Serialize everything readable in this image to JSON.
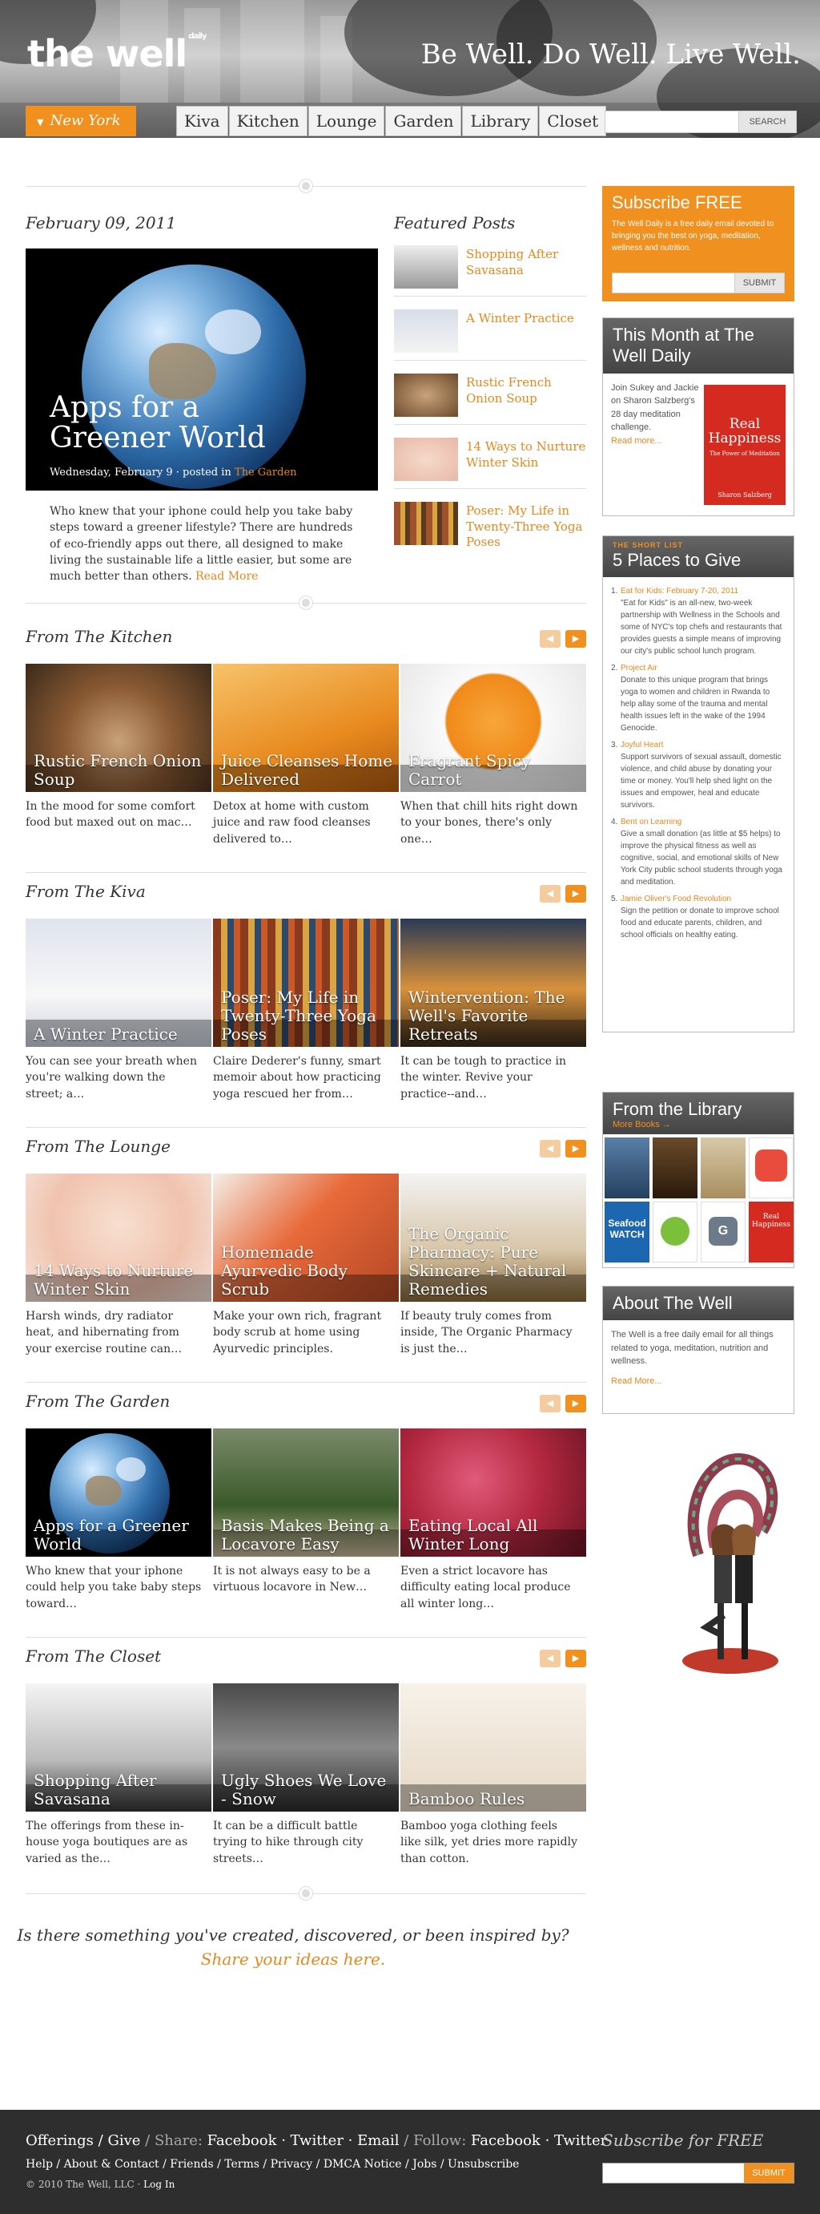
{
  "header": {
    "logo": "the well",
    "logo_sup": "daily",
    "tagline": "Be Well. Do Well. Live Well.",
    "city": "New York",
    "tabs": [
      "Kiva",
      "Kitchen",
      "Lounge",
      "Garden",
      "Library",
      "Closet"
    ],
    "search_button": "SEARCH",
    "search_value": ""
  },
  "main": {
    "date": "February 09, 2011",
    "hero": {
      "title": "Apps for a Greener World",
      "meta_date": "Wednesday, February 9",
      "meta_posted": "· posted in",
      "meta_category": "The Garden",
      "excerpt": "Who knew that your iphone could help you take baby steps toward a greener lifestyle? There are hundreds of eco-friendly apps out there, all designed to make living the sustainable life a little easier, but some are much better than others.",
      "read_more": "Read More"
    },
    "featured_title": "Featured Posts",
    "featured": [
      {
        "label": "Shopping After Savasana"
      },
      {
        "label": "A Winter Practice"
      },
      {
        "label": "Rustic French Onion Soup"
      },
      {
        "label": "14 Ways to Nurture Winter Skin"
      },
      {
        "label": "Poser: My Life in Twenty-Three Yoga Poses"
      }
    ],
    "sections": [
      {
        "title": "From The Kitchen",
        "cards": [
          {
            "caption": "Rustic French Onion Soup",
            "text": "In the mood for some comfort food but maxed out on mac…"
          },
          {
            "caption": "Juice Cleanses Home Delivered",
            "text": "Detox at home with custom juice and raw food cleanses delivered to…"
          },
          {
            "caption": "Fragrant Spicy Carrot",
            "text": "When that chill hits right down to your bones, there's only one…"
          }
        ]
      },
      {
        "title": "From The Kiva",
        "cards": [
          {
            "caption": "A Winter Practice",
            "text": "You can see your breath when you're walking down the street; a…"
          },
          {
            "caption": "Poser: My Life in Twenty-Three Yoga Poses",
            "text": "Claire Dederer's funny, smart memoir about how practicing yoga rescued her from…"
          },
          {
            "caption": "Wintervention: The Well's Favorite Retreats",
            "text": "It can be tough to practice in the winter. Revive your practice--and…"
          }
        ]
      },
      {
        "title": "From The Lounge",
        "cards": [
          {
            "caption": "14 Ways to Nurture Winter Skin",
            "text": "Harsh winds, dry radiator heat, and hibernating from your exercise routine can…"
          },
          {
            "caption": "Homemade Ayurvedic Body Scrub",
            "text": "Make your own rich, fragrant body scrub at home using Ayurvedic principles."
          },
          {
            "caption": "The Organic Pharmacy: Pure Skincare + Natural Remedies",
            "text": "If beauty truly comes from inside, The Organic Pharmacy is just the…"
          }
        ]
      },
      {
        "title": "From The Garden",
        "cards": [
          {
            "caption": "Apps for a Greener World",
            "text": "Who knew that your iphone could help you take baby steps toward…"
          },
          {
            "caption": "Basis Makes Being a Locavore Easy",
            "text": "It is not always easy to be a virtuous locavore in New…"
          },
          {
            "caption": "Eating Local All Winter Long",
            "text": "Even a strict locavore has difficulty eating local produce all winter long…"
          }
        ]
      },
      {
        "title": "From The Closet",
        "cards": [
          {
            "caption": "Shopping After Savasana",
            "text": "The offerings from these in-house yoga boutiques are as varied as the…"
          },
          {
            "caption": "Ugly Shoes We Love - Snow",
            "text": "It can be a difficult battle trying to hike through city streets…"
          },
          {
            "caption": "Bamboo Rules",
            "text": "Bamboo yoga clothing feels like silk, yet dries more rapidly than cotton."
          }
        ]
      }
    ],
    "cta_question": "Is there something you've created, discovered, or been inspired by?",
    "cta_link": "Share your ideas here."
  },
  "sidebar": {
    "subscribe": {
      "title": "Subscribe FREE",
      "text": "The Well Daily is a free daily email devoted to bringing you the best on yoga, meditation, wellness and nutrition.",
      "button": "SUBMIT"
    },
    "this_month": {
      "title": "This Month at The Well Daily",
      "text": "Join Sukey and Jackie on Sharon Salzberg's 28 day meditation challenge.",
      "read_more": "Read more...",
      "book_title": "Real Happiness",
      "book_sub": "The Power of Meditation",
      "book_author": "Sharon Salzberg"
    },
    "short_list": {
      "kicker": "THE SHORT LIST",
      "title": "5 Places to Give",
      "items": [
        {
          "num": "1.",
          "title": "Eat for Kids: February 7-20, 2011",
          "text": "\"Eat for Kids\" is an all-new, two-week partnership with Wellness in the Schools and some of NYC's top chefs and restaurants that provides guests a simple means of improving our city's public school lunch program."
        },
        {
          "num": "2.",
          "title": "Project Air",
          "text": "Donate to this unique program that brings yoga to women and children in Rwanda to help allay some of the trauma and mental health issues left in the wake of the 1994 Genocide."
        },
        {
          "num": "3.",
          "title": "Joyful Heart",
          "text": "Support survivors of sexual assault, domestic violence, and child abuse by donating your time or money. You'll help shed light on the issues and empower, heal and educate survivors."
        },
        {
          "num": "4.",
          "title": "Bent on Learning",
          "text": "Give a small donation (as little at $5 helps) to improve the physical fitness as well as cognitive, social, and emotional skills of New York City public school students through yoga and meditation."
        },
        {
          "num": "5.",
          "title": "Jamie Oliver's Food Revolution",
          "text": "Sign the petition or donate to improve school food and educate parents, children, and school officials on healthy eating."
        }
      ]
    },
    "library": {
      "title": "From the Library",
      "more": "More Books →",
      "seafood_label": "Seafood WATCH",
      "book_label": "Real Happiness"
    },
    "about": {
      "title": "About The Well",
      "text": "The Well is a free daily email for all things related to yoga, meditation, nutrition and wellness.",
      "read_more": "Read More..."
    }
  },
  "footer": {
    "links1": [
      "Offerings",
      "Give"
    ],
    "share_label": "Share:",
    "share": [
      "Facebook",
      "Twitter",
      "Email"
    ],
    "follow_label": "Follow:",
    "follow": [
      "Facebook",
      "Twitter"
    ],
    "links2": [
      "Help",
      "About & Contact",
      "Friends",
      "Terms",
      "Privacy",
      "DMCA Notice",
      "Jobs",
      "Unsubscribe"
    ],
    "copyright": "© 2010 The Well, LLC ·",
    "login": "Log In",
    "subscribe_title": "Subscribe for FREE",
    "subscribe_button": "SUBMIT"
  },
  "colors": {
    "accent": "#f0901e",
    "link": "#e8871e",
    "footer_bg": "#2e2e2e",
    "sidebar_header": "#555555"
  }
}
